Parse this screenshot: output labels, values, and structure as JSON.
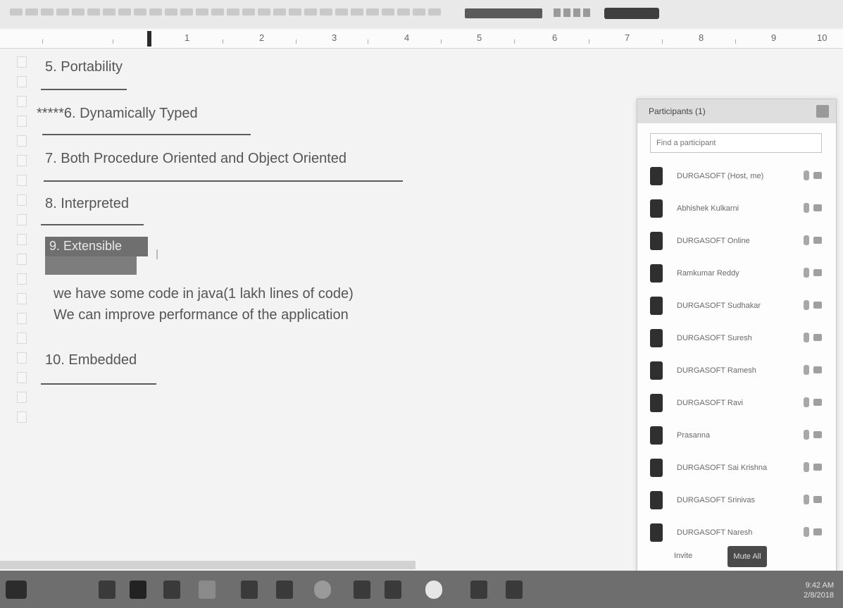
{
  "ruler": {
    "numbers": [
      "1",
      "2",
      "3",
      "4",
      "5",
      "6",
      "7",
      "8",
      "9",
      "10"
    ]
  },
  "document": {
    "lines": [
      {
        "text": "5. Portability"
      },
      {
        "text": "*****6. Dynamically Typed"
      },
      {
        "text": "7. Both Procedure Oriented and Object Oriented"
      },
      {
        "text": "8. Interpreted"
      },
      {
        "text": "9. Extensible"
      },
      {
        "text": "we have some code in java(1 lakh lines of code)"
      },
      {
        "text": "We can improve performance of the application"
      },
      {
        "text": "10. Embedded"
      }
    ]
  },
  "side_panel": {
    "title": "Participants (1)",
    "search_placeholder": "Find a participant",
    "participants": [
      {
        "name": "DURGASOFT (Host, me)"
      },
      {
        "name": "Abhishek Kulkarni"
      },
      {
        "name": "DURGASOFT Online"
      },
      {
        "name": "Ramkumar Reddy"
      },
      {
        "name": "DURGASOFT Sudhakar"
      },
      {
        "name": "DURGASOFT Suresh"
      },
      {
        "name": "DURGASOFT Ramesh"
      },
      {
        "name": "DURGASOFT Ravi"
      },
      {
        "name": "Prasanna"
      },
      {
        "name": "DURGASOFT Sai Krishna"
      },
      {
        "name": "DURGASOFT Srinivas"
      },
      {
        "name": "DURGASOFT Naresh"
      }
    ],
    "footer_left": "Invite",
    "footer_button": "Mute All"
  },
  "taskbar": {
    "clock_time": "9:42 AM",
    "clock_date": "2/8/2018"
  }
}
